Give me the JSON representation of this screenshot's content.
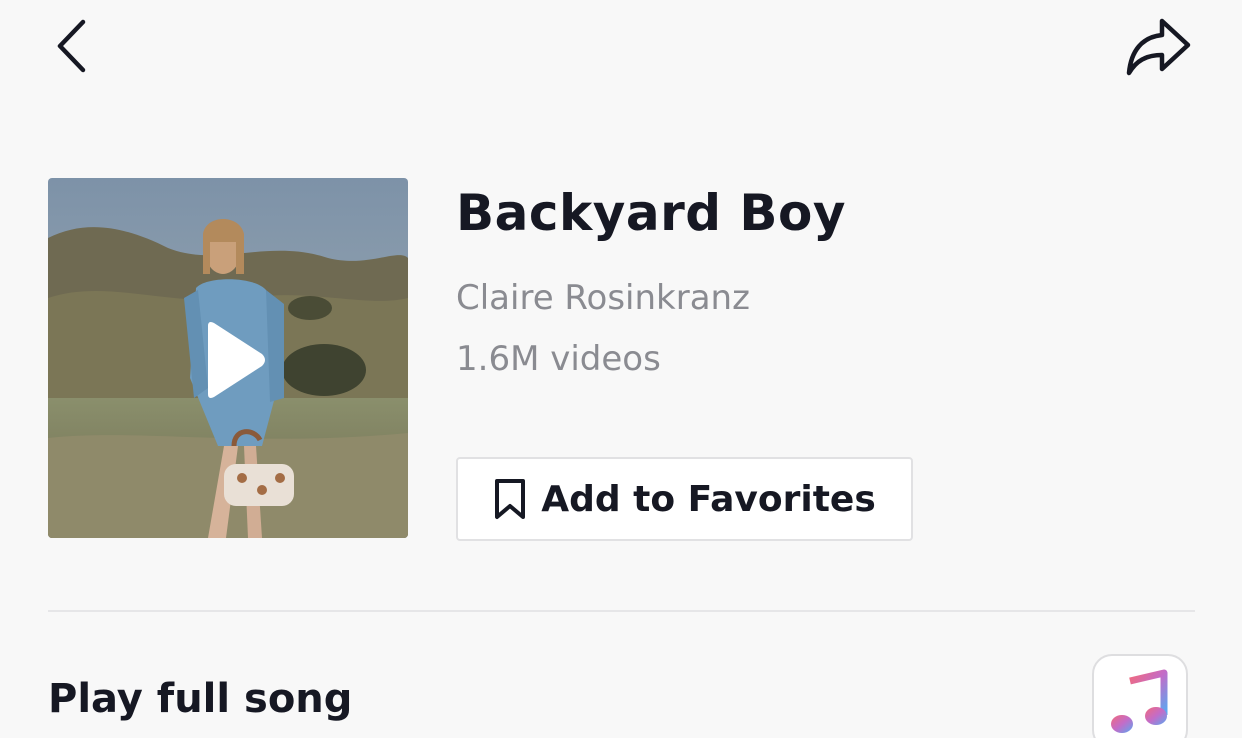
{
  "header": {
    "back_icon": "chevron-left-icon",
    "share_icon": "share-arrow-icon"
  },
  "sound": {
    "title": "Backyard Boy",
    "artist": "Claire Rosinkranz",
    "video_count": "1.6M videos",
    "cover_icon": "play-icon"
  },
  "favorites": {
    "label": "Add to Favorites",
    "icon": "bookmark-icon"
  },
  "full_song": {
    "label": "Play full song",
    "app_icon": "music-note-icon"
  },
  "colors": {
    "primary_text": "#161823",
    "secondary_text": "#8a8b91",
    "background": "#f8f8f8",
    "border": "#e1e1e3"
  }
}
